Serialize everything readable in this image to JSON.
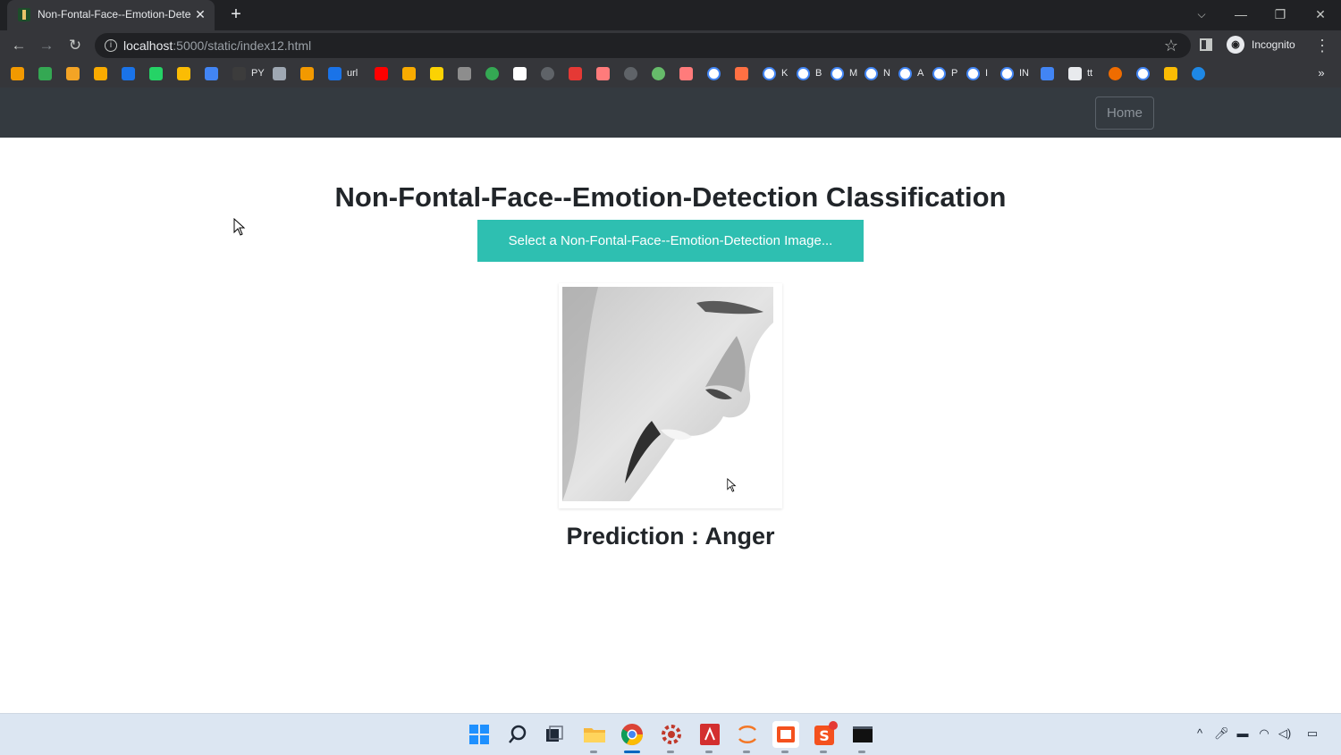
{
  "browser": {
    "tab": {
      "title": "Non-Fontal-Face--Emotion-Detection Classification",
      "close": "✕"
    },
    "new_tab": "+",
    "window_controls": {
      "tab_search": "⌵",
      "minimize": "—",
      "restore": "❐",
      "close": "✕"
    },
    "nav": {
      "back": "←",
      "forward": "→",
      "reload": "↻"
    },
    "url": {
      "host": "localhost",
      "rest": ":5000/static/index12.html"
    },
    "profile": {
      "label": "Incognito"
    },
    "bookmarks": [
      {
        "icon": "flame-icon",
        "color": "#f29900",
        "label": ""
      },
      {
        "icon": "chat-icon",
        "color": "#34a853",
        "label": ""
      },
      {
        "icon": "orange-app-icon",
        "color": "#f4a425",
        "label": ""
      },
      {
        "icon": "analytics-icon",
        "color": "#f9ab00",
        "label": ""
      },
      {
        "icon": "calendar-icon",
        "color": "#1a73e8",
        "label": ""
      },
      {
        "icon": "whatsapp-icon",
        "color": "#25d366",
        "label": ""
      },
      {
        "icon": "ads-icon",
        "color": "#fbbc04",
        "label": ""
      },
      {
        "icon": "adsense-icon",
        "color": "#4285f4",
        "label": ""
      },
      {
        "icon": "python-icon",
        "color": "#3c3c3c",
        "label": "PY"
      },
      {
        "icon": "car-icon",
        "color": "#9fa8b3",
        "label": ""
      },
      {
        "icon": "tower-icon",
        "color": "#f29900",
        "label": ""
      },
      {
        "icon": "shield-icon",
        "color": "#1a73e8",
        "label": "url"
      },
      {
        "icon": "youtube-icon",
        "color": "#ff0000",
        "label": ""
      },
      {
        "icon": "pencil-icon",
        "color": "#f9ab00",
        "label": ""
      },
      {
        "icon": "p-icon",
        "color": "#fbd203",
        "label": ""
      },
      {
        "icon": "glasses-icon",
        "color": "#8d8d8d",
        "label": ""
      },
      {
        "icon": "ring-icon",
        "color": "#34a853",
        "label": ""
      },
      {
        "icon": "document-icon",
        "color": "#ffffff",
        "label": ""
      },
      {
        "icon": "globe-icon",
        "color": "#5f6368",
        "label": ""
      },
      {
        "icon": "heart-icon",
        "color": "#e53935",
        "label": ""
      },
      {
        "icon": "pdf-icon",
        "color": "#ff7b7b",
        "label": ""
      },
      {
        "icon": "globe-icon",
        "color": "#5f6368",
        "label": ""
      },
      {
        "icon": "globe-color-icon",
        "color": "#66bb6a",
        "label": ""
      },
      {
        "icon": "pdf-icon",
        "color": "#ff7b7b",
        "label": ""
      },
      {
        "icon": "google-icon",
        "color": "#ffffff",
        "label": ""
      },
      {
        "icon": "arrow-icon",
        "color": "#ff7043",
        "label": ""
      },
      {
        "icon": "google-icon",
        "color": "#ffffff",
        "label": "K"
      },
      {
        "icon": "google-icon",
        "color": "#ffffff",
        "label": "B"
      },
      {
        "icon": "google-icon",
        "color": "#ffffff",
        "label": "M"
      },
      {
        "icon": "google-icon",
        "color": "#ffffff",
        "label": "N"
      },
      {
        "icon": "google-icon",
        "color": "#ffffff",
        "label": "A"
      },
      {
        "icon": "google-icon",
        "color": "#ffffff",
        "label": "P"
      },
      {
        "icon": "google-icon",
        "color": "#ffffff",
        "label": "I"
      },
      {
        "icon": "google-icon",
        "color": "#ffffff",
        "label": "IN"
      },
      {
        "icon": "mountain-icon",
        "color": "#4285f4",
        "label": ""
      },
      {
        "icon": "monitor-icon",
        "color": "#e8eaed",
        "label": "tt"
      },
      {
        "icon": "orange-circle-icon",
        "color": "#ef6c00",
        "label": ""
      },
      {
        "icon": "google-icon",
        "color": "#ffffff",
        "label": ""
      },
      {
        "icon": "pinwheel-icon",
        "color": "#fbbc04",
        "label": ""
      },
      {
        "icon": "blue-circle-icon",
        "color": "#1e88e5",
        "label": ""
      }
    ],
    "bookmarks_more": "»"
  },
  "page": {
    "nav_home": "Home",
    "heading": "Non-Fontal-Face--Emotion-Detection Classification",
    "select_button": "Select a Non-Fontal-Face--Emotion-Detection Image...",
    "prediction": "Prediction : Anger",
    "colors": {
      "navbar": "#343a40",
      "button": "#2ebfb1",
      "text": "#212529"
    }
  },
  "taskbar": {
    "apps": [
      {
        "name": "start-icon",
        "active": false
      },
      {
        "name": "search-icon",
        "active": false
      },
      {
        "name": "task-view-icon",
        "active": false
      },
      {
        "name": "file-explorer-icon",
        "active": true
      },
      {
        "name": "chrome-icon",
        "active": true
      },
      {
        "name": "gear-app-icon",
        "active": true
      },
      {
        "name": "acrobat-icon",
        "active": true
      },
      {
        "name": "jupyter-icon",
        "active": true
      },
      {
        "name": "powerpoint-icon",
        "active": true
      },
      {
        "name": "sublime-icon",
        "active": true
      },
      {
        "name": "terminal-icon",
        "active": true
      }
    ],
    "tray": [
      "chevron-up-icon",
      "microphone-icon",
      "battery-icon",
      "wifi-icon",
      "volume-icon",
      "notification-icon"
    ]
  }
}
